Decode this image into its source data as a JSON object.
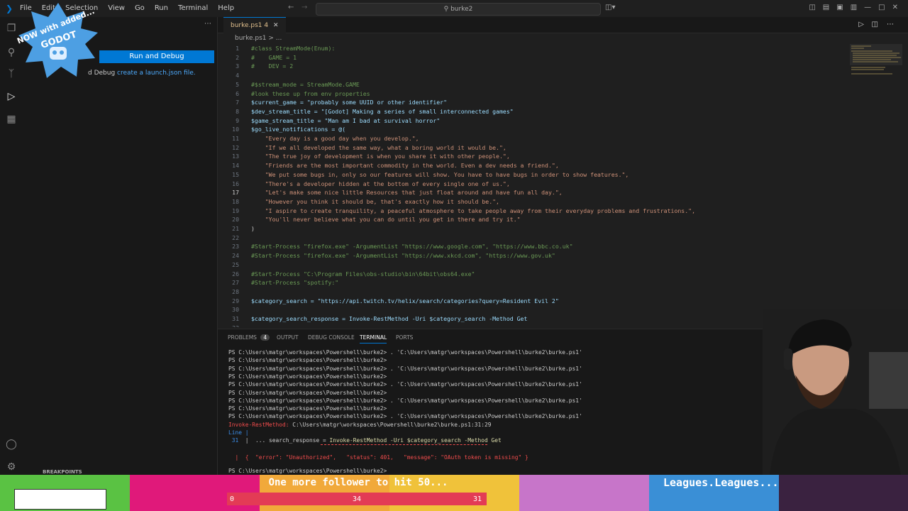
{
  "titlebar": {
    "menu": [
      "File",
      "Edit",
      "Selection",
      "View",
      "Go",
      "Run",
      "Terminal",
      "Help"
    ],
    "search": "burke2"
  },
  "sidebar": {
    "run_button": "Run and Debug",
    "debug_text": "d Debug",
    "launch_link": "create a launch.json file.",
    "breakpoints": "BREAKPOINTS",
    "overlay_badge_text": "NOW with added... GODOT"
  },
  "editor": {
    "tab_label": "burke.ps1",
    "tab_count": "4",
    "breadcrumb": "burke.ps1 > ...",
    "lines": [
      "#class StreamMode(Enum):",
      "#    GAME = 1",
      "#    DEV = 2",
      "",
      "#$stream_mode = StreamMode.GAME",
      "#look these up from env properties",
      "$current_game = \"probably some UUID or other identifier\"",
      "$dev_stream_title = \"[Godot] Making a series of small interconnected games\"",
      "$game_stream_title = \"Man am I bad at survival horror\"",
      "$go_live_notifications = @(",
      "    \"Every day is a good day when you develop.\",",
      "    \"If we all developed the same way, what a boring world it would be.\",",
      "    \"The true joy of development is when you share it with other people.\",",
      "    \"Friends are the most important commodity in the world. Even a dev needs a friend.\",",
      "    \"We put some bugs in, only so our features will show. You have to have bugs in order to show features.\",",
      "    \"There's a developer hidden at the bottom of every single one of us.\",",
      "    \"Let's make some nice little Resources that just float around and have fun all day.\",",
      "    \"However you think it should be, that's exactly how it should be.\",",
      "    \"I aspire to create tranquility, a peaceful atmosphere to take people away from their everyday problems and frustrations.\",",
      "    \"You'll never believe what you can do until you get in there and try it.\"",
      ")",
      "",
      "#Start-Process \"firefox.exe\" -ArgumentList \"https://www.google.com\", \"https://www.bbc.co.uk\"",
      "#Start-Process \"firefox.exe\" -ArgumentList \"https://www.xkcd.com\", \"https://www.gov.uk\"",
      "",
      "#Start-Process \"C:\\Program Files\\obs-studio\\bin\\64bit\\obs64.exe\"",
      "#Start-Process \"spotify:\"",
      "",
      "$category_search = \"https://api.twitch.tv/helix/search/categories?query=Resident Evil 2\"",
      "",
      "$category_search_response = Invoke-RestMethod -Uri $category_search -Method Get",
      ""
    ]
  },
  "panel": {
    "tabs": [
      "PROBLEMS",
      "OUTPUT",
      "DEBUG CONSOLE",
      "TERMINAL",
      "PORTS"
    ],
    "problems_count": "4",
    "terminal_lines": [
      "PS C:\\Users\\matgr\\workspaces\\Powershell\\burke2> . 'C:\\Users\\matgr\\workspaces\\Powershell\\burke2\\burke.ps1'",
      "PS C:\\Users\\matgr\\workspaces\\Powershell\\burke2>",
      "PS C:\\Users\\matgr\\workspaces\\Powershell\\burke2> . 'C:\\Users\\matgr\\workspaces\\Powershell\\burke2\\burke.ps1'",
      "PS C:\\Users\\matgr\\workspaces\\Powershell\\burke2>",
      "PS C:\\Users\\matgr\\workspaces\\Powershell\\burke2> . 'C:\\Users\\matgr\\workspaces\\Powershell\\burke2\\burke.ps1'",
      "PS C:\\Users\\matgr\\workspaces\\Powershell\\burke2>",
      "PS C:\\Users\\matgr\\workspaces\\Powershell\\burke2> . 'C:\\Users\\matgr\\workspaces\\Powershell\\burke2\\burke.ps1'",
      "PS C:\\Users\\matgr\\workspaces\\Powershell\\burke2>",
      "PS C:\\Users\\matgr\\workspaces\\Powershell\\burke2> . 'C:\\Users\\matgr\\workspaces\\Powershell\\burke2\\burke.ps1'"
    ],
    "error_prefix": "Invoke-RestMethod:",
    "error_path": " C:\\Users\\matgr\\workspaces\\Powershell\\burke2\\burke.ps1:31:29",
    "line_label": "Line |",
    "line_num": "31",
    "error_code_plain": "  |  ... search_response = ",
    "error_code_hl": "Invoke-RestMethod -Uri $category_search -Method Get",
    "error_msg": "  |  {  \"error\": \"Unauthorized\",   \"status\": 401,   \"message\": \"OAuth token is missing\" }",
    "last_prompt": "PS C:\\Users\\matgr\\workspaces\\Powershell\\burke2> "
  },
  "overlay": {
    "follower_goal": "One more follower to hit 50...",
    "bar_min": "0",
    "bar_value": "34",
    "bar_max": "31",
    "bar_fraction": 0,
    "ticker": "Leagues.Leagues..."
  },
  "colors": {
    "accent": "#0078d4",
    "stripe_green": "#5ac243",
    "stripe_pink": "#e0197a",
    "stripe_orange": "#f1a93a",
    "stripe_purple": "#c775c9",
    "stripe_blue": "#3a8fd6"
  }
}
